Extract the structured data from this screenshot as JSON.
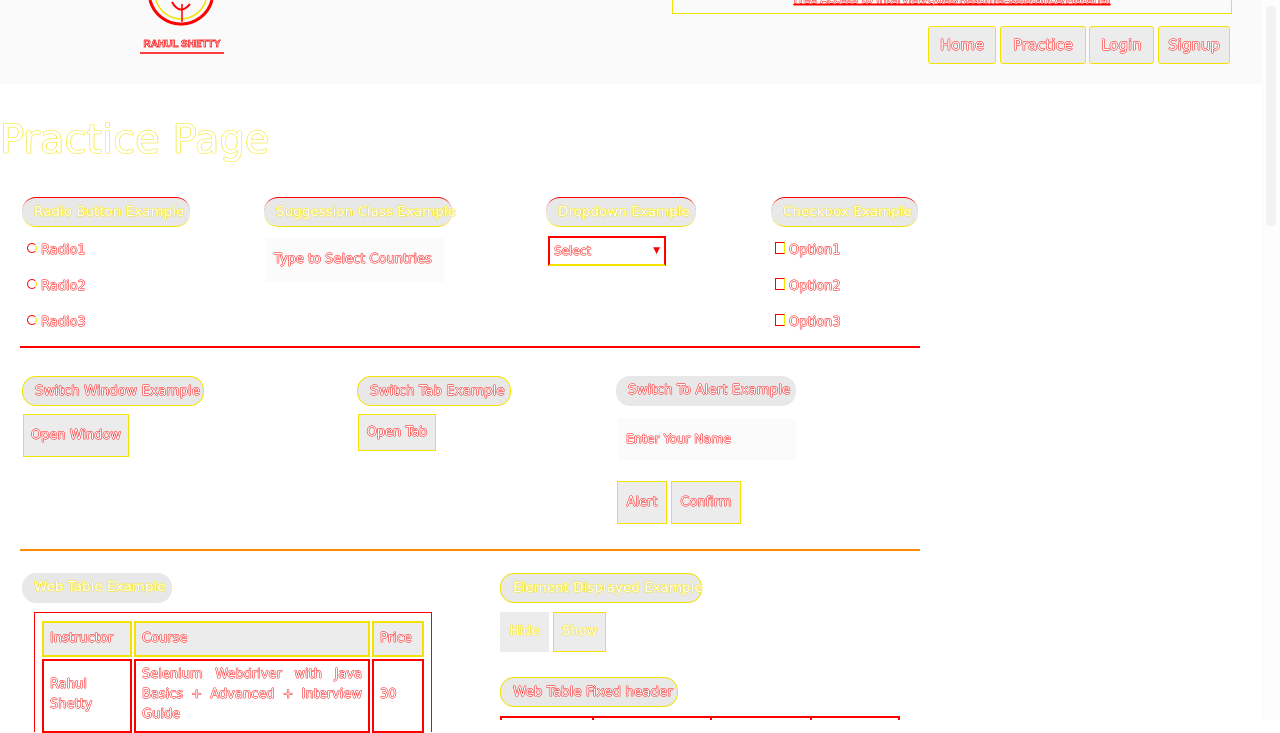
{
  "header": {
    "logo_text": "RAHUL SHETTY",
    "promo_text": "Free Access to InterviewQues/ResumeAssistance/Material",
    "nav": [
      {
        "label": "Home"
      },
      {
        "label": "Practice"
      },
      {
        "label": "Login"
      },
      {
        "label": "Signup"
      }
    ]
  },
  "page": {
    "title": "Practice Page"
  },
  "radio_section": {
    "legend": "Radio Button Example",
    "options": [
      {
        "label": "Radio1"
      },
      {
        "label": "Radio2"
      },
      {
        "label": "Radio3"
      }
    ]
  },
  "suggestion_section": {
    "legend": "Suggession Class Example",
    "placeholder": "Type to Select Countries"
  },
  "dropdown_section": {
    "legend": "Dropdown Example",
    "selected": "Select"
  },
  "checkbox_section": {
    "legend": "Checkbox Example",
    "options": [
      {
        "label": "Option1"
      },
      {
        "label": "Option2"
      },
      {
        "label": "Option3"
      }
    ]
  },
  "switch_window_section": {
    "legend": "Switch Window Example",
    "button": "Open Window"
  },
  "switch_tab_section": {
    "legend": "Switch Tab Example",
    "button": "Open Tab"
  },
  "alert_section": {
    "legend": "Switch To Alert Example",
    "placeholder": "Enter Your Name",
    "alert_button": "Alert",
    "confirm_button": "Confirm"
  },
  "web_table_section": {
    "legend": "Web Table Example",
    "headers": [
      "Instructor",
      "Course",
      "Price"
    ],
    "rows": [
      {
        "instructor": "Rahul Shetty",
        "course": "Selenium Webdriver with Java Basics + Advanced + Interview Guide",
        "price": "30"
      }
    ]
  },
  "element_display_section": {
    "legend": "Element Displayed Example",
    "hide_button": "Hide",
    "show_button": "Show"
  },
  "fixed_header_section": {
    "legend": "Web Table Fixed header"
  },
  "colors": {
    "accent_red": "#ff0000",
    "accent_yellow": "#f4e200",
    "panel_grey": "#e8e8e8"
  }
}
